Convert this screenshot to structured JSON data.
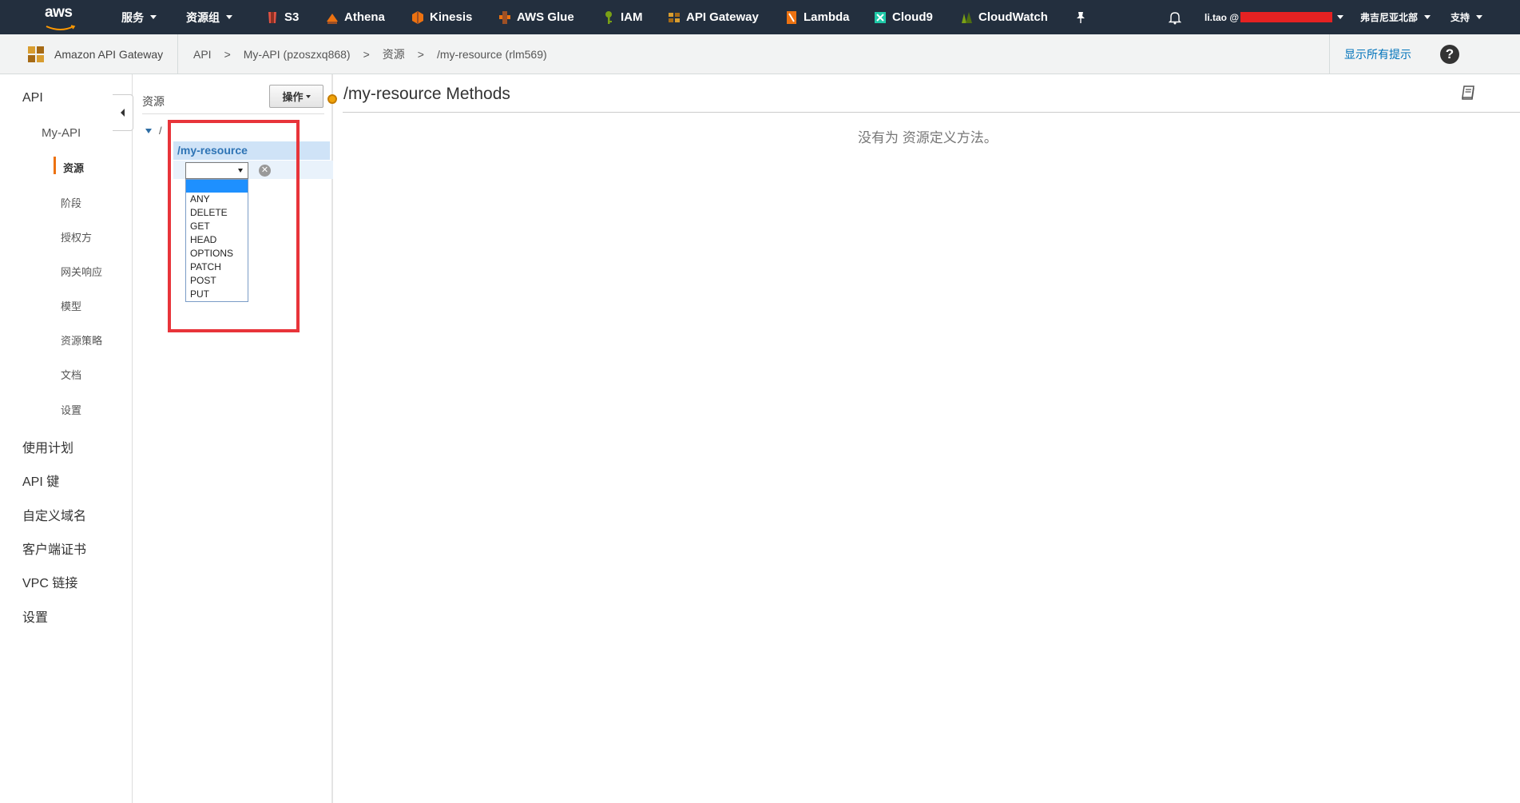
{
  "topnav": {
    "logo": "aws",
    "services": "服务",
    "resource_groups": "资源组",
    "shortcuts": [
      {
        "label": "S3",
        "icon": "s3-icon",
        "color": "#e05243"
      },
      {
        "label": "Athena",
        "icon": "athena-icon",
        "color": "#ec7211"
      },
      {
        "label": "Kinesis",
        "icon": "kinesis-icon",
        "color": "#ec7211"
      },
      {
        "label": "AWS Glue",
        "icon": "glue-icon",
        "color": "#ec7211"
      },
      {
        "label": "IAM",
        "icon": "iam-icon",
        "color": "#7aa116"
      },
      {
        "label": "API Gateway",
        "icon": "api-gateway-icon",
        "color": "#d89d30"
      },
      {
        "label": "Lambda",
        "icon": "lambda-icon",
        "color": "#ec7211"
      },
      {
        "label": "Cloud9",
        "icon": "cloud9-icon",
        "color": "#1ec9a8"
      },
      {
        "label": "CloudWatch",
        "icon": "cloudwatch-icon",
        "color": "#7aa116"
      }
    ],
    "user": "li.tao @",
    "region": "弗吉尼亚北部",
    "support": "支持"
  },
  "subheader": {
    "brand": "Amazon API Gateway",
    "breadcrumbs": [
      "API",
      "My-API (pzoszxq868)",
      "资源",
      "/my-resource (rlm569)"
    ],
    "tips": "显示所有提示"
  },
  "leftnav": {
    "api": "API",
    "myapi": "My-API",
    "sub": [
      "资源",
      "阶段",
      "授权方",
      "网关响应",
      "模型",
      "资源策略",
      "文档",
      "设置"
    ],
    "top": [
      "使用计划",
      "API 键",
      "自定义域名",
      "客户端证书",
      "VPC 链接",
      "设置"
    ]
  },
  "tree": {
    "title": "资源",
    "actions": "操作",
    "root": "/",
    "resource": "/my-resource",
    "methods": [
      "ANY",
      "DELETE",
      "GET",
      "HEAD",
      "OPTIONS",
      "PATCH",
      "POST",
      "PUT"
    ]
  },
  "main": {
    "title": "/my-resource Methods",
    "empty": "没有为 资源定义方法。"
  },
  "colors": {
    "nav_bg": "#232f3e",
    "accent": "#ec7211",
    "link": "#0073bb",
    "highlight": "#e8343a"
  }
}
